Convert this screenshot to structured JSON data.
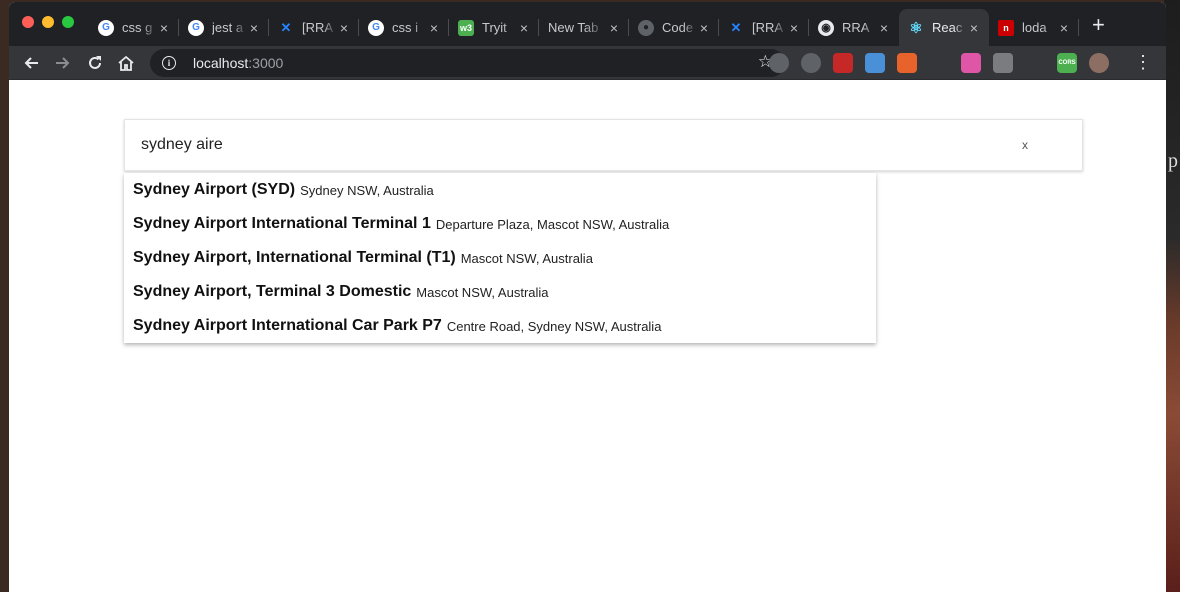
{
  "browser": {
    "tabs": [
      {
        "title": "css g",
        "favicon": "google-icon"
      },
      {
        "title": "jest a",
        "favicon": "google-icon"
      },
      {
        "title": "[RRA",
        "favicon": "jira-icon"
      },
      {
        "title": "css i",
        "favicon": "google-icon"
      },
      {
        "title": "Tryit",
        "favicon": "w3schools-icon"
      },
      {
        "title": "New Tab",
        "favicon": ""
      },
      {
        "title": "Code",
        "favicon": "globe-icon"
      },
      {
        "title": "[RRA",
        "favicon": "jira-icon"
      },
      {
        "title": "RRA",
        "favicon": "github-icon"
      },
      {
        "title": "Reac",
        "favicon": "react-icon",
        "active": true
      },
      {
        "title": "loda",
        "favicon": "npm-icon"
      }
    ],
    "new_tab_label": "+",
    "close_glyph": "×",
    "url_host": "localhost",
    "url_port": ":3000",
    "extensions": [
      "extension-1",
      "extension-2",
      "extension-3",
      "extension-4",
      "extension-5",
      "extension-6",
      "extension-7",
      "extension-8",
      "extension-9",
      "cors-extension",
      "profile-avatar"
    ],
    "cors_label": "CORS"
  },
  "search": {
    "value": "sydney aire",
    "clear_label": "x"
  },
  "suggestions": [
    {
      "main": "Sydney Airport (SYD)",
      "secondary": "Sydney NSW, Australia"
    },
    {
      "main": "Sydney Airport International Terminal 1",
      "secondary": "Departure Plaza, Mascot NSW, Australia"
    },
    {
      "main": "Sydney Airport, International Terminal (T1)",
      "secondary": "Mascot NSW, Australia"
    },
    {
      "main": "Sydney Airport, Terminal 3 Domestic",
      "secondary": "Mascot NSW, Australia"
    },
    {
      "main": "Sydney Airport International Car Park P7",
      "secondary": "Centre Road, Sydney NSW, Australia"
    }
  ]
}
